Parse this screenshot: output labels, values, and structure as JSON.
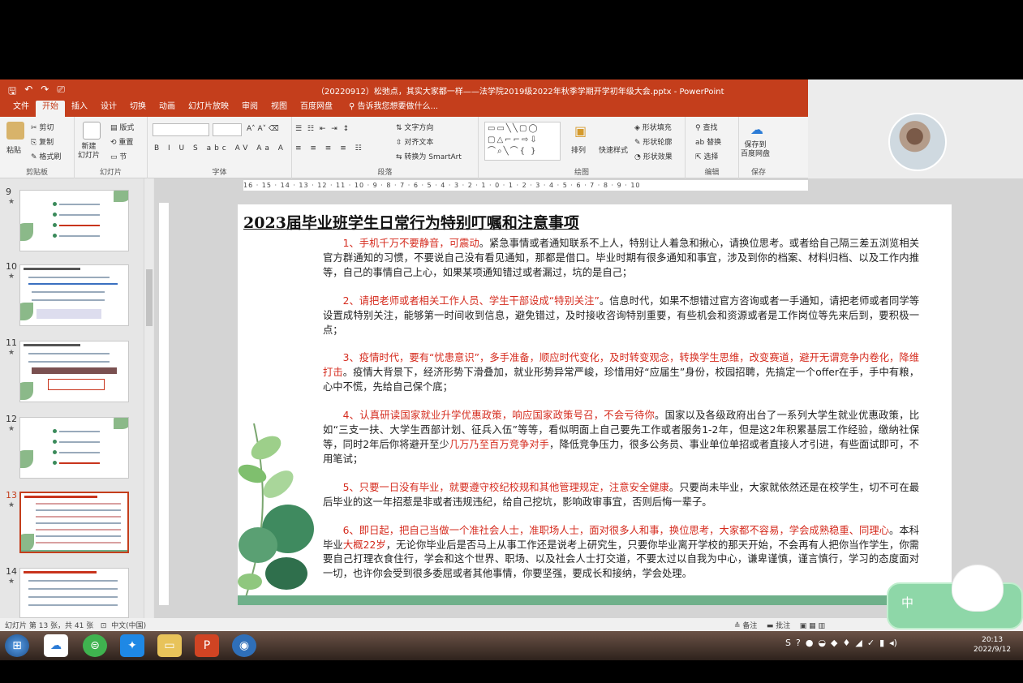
{
  "window": {
    "title": "（20220912）松弛点，其实大家都一样——法学院2019级2022年秋季学期开学初年级大会.pptx - PowerPoint",
    "qat": [
      "🖫",
      "↶",
      "↷",
      "⎚"
    ]
  },
  "ribbon_tabs": [
    "文件",
    "开始",
    "插入",
    "设计",
    "切换",
    "动画",
    "幻灯片放映",
    "审阅",
    "视图",
    "百度网盘"
  ],
  "tell_me": "告诉我您想要做什么...",
  "ribbon": {
    "clipboard": {
      "paste": "粘贴",
      "cut": "剪切",
      "copy": "复制",
      "format_painter": "格式刷",
      "label": "剪贴板"
    },
    "slides": {
      "new_slide": "新建\n幻灯片",
      "layout": "版式",
      "reset": "重置",
      "section": "节",
      "label": "幻灯片"
    },
    "font": {
      "label": "字体"
    },
    "paragraph": {
      "text_direction": "文字方向",
      "align_text": "对齐文本",
      "smartart": "转换为 SmartArt",
      "label": "段落"
    },
    "drawing": {
      "arrange": "排列",
      "quick_styles": "快速样式",
      "shape_fill": "形状填充",
      "shape_outline": "形状轮廓",
      "shape_effects": "形状效果",
      "label": "绘图"
    },
    "editing": {
      "find": "查找",
      "replace": "替换",
      "select": "选择",
      "label": "编辑"
    },
    "save": {
      "save_baidu": "保存到\n百度网盘",
      "label": "保存"
    }
  },
  "ruler_text": "16 · 15 · 14 · 13 · 12 · 11 · 10 · 9 · 8 · 7 · 6 · 5 · 4 · 3 · 2 · 1 · 0 · 1 · 2 · 3 · 4 · 5 · 6 · 7 · 8 · 9 · 10",
  "thumbnails": [
    {
      "num": "9",
      "star": "★"
    },
    {
      "num": "10",
      "star": "★"
    },
    {
      "num": "11",
      "star": "★"
    },
    {
      "num": "12",
      "star": "★"
    },
    {
      "num": "13",
      "star": "★"
    },
    {
      "num": "14",
      "star": "★"
    }
  ],
  "slide": {
    "title": "2023届毕业班学生日常行为特别叮嘱和注意事项",
    "paragraphs": [
      {
        "red": "1、手机千万不要静音，可震动",
        "black": "。紧急事情或者通知联系不上人，特别让人着急和揪心，请换位思考。或者给自己隔三差五浏览相关官方群通知的习惯，不要说自己没有看见通知，那都是借口。毕业时期有很多通知和事宜，涉及到你的档案、材料归档、以及工作内推等，自己的事情自己上心，如果某项通知错过或者漏过，坑的是自己；"
      },
      {
        "red": "2、请把老师或者相关工作人员、学生干部设成“特别关注”",
        "black": "。信息时代，如果不想错过官方咨询或者一手通知，请把老师或者同学等设置成特别关注，能够第一时间收到信息，避免错过，及时接收咨询特别重要，有些机会和资源或者是工作岗位等先来后到，要积极一点；"
      },
      {
        "red": "3、疫情时代，要有“忧患意识”，多手准备，顺应时代变化，及时转变观念，转换学生思维，改变赛道，避开无谓竞争内卷化，降维打击",
        "black": "。疫情大背景下，经济形势下滑叠加，就业形势异常严峻，珍惜用好“应届生”身份，校园招聘，先搞定一个offer在手，手中有粮，心中不慌，先给自己保个底；"
      },
      {
        "red": "4、认真研读国家就业升学优惠政策，响应国家政策号召，不会亏待你",
        "black": "。国家以及各级政府出台了一系列大学生就业优惠政策，比如“三支一扶、大学生西部计划、征兵入伍”等等，看似明面上自己要先工作或者服务1-2年，但是这2年积累基层工作经验，缴纳社保等，同时2年后你将避开至少",
        "red2": "几万乃至百万竞争对手",
        "black2": "，降低竞争压力，很多公务员、事业单位单招或者直接人才引进，有些面试即可，不用笔试；"
      },
      {
        "red": "5、只要一日没有毕业，就要遵守校纪校规和其他管理规定，注意安全健康",
        "black": "。只要尚未毕业，大家就依然还是在校学生，切不可在最后毕业的这一年招惹是非或者违规违纪，给自己挖坑，影响政审事宜，否则后悔一辈子。"
      },
      {
        "red": "6、即日起，把自己当做一个准社会人士，准职场人士，面对很多人和事，换位思考，大家都不容易，学会成熟稳重、同理心",
        "black": "。本科毕业",
        "red2": "大概22岁",
        "black2": "，无论你毕业后是否马上从事工作还是说考上研究生，只要你毕业离开学校的那天开始，不会再有人把你当作学生，你需要自己打理衣食住行，学会和这个世界、职场、以及社会人士打交道，不要太过以自我为中心，谦卑谨慎，谨言慎行，学习的态度面对一切，也许你会受到很多委屈或者其他事情，你要坚强，要成长和接纳，学会处理。"
      }
    ]
  },
  "status": {
    "slide_info": "幻灯片 第 13 张，共 41 张",
    "language": "中文(中国)",
    "notes": "备注",
    "comments": "批注"
  },
  "taskbar": {
    "icons": [
      "start-orb",
      "baidu-netdisk",
      "browser",
      "feishu",
      "explorer",
      "powerpoint",
      "app"
    ],
    "clock_time": "20:13",
    "clock_date": "2022/9/12"
  },
  "ime": {
    "label": "中"
  },
  "colors": {
    "accent": "#c43e1c",
    "red_text": "#d52b1e",
    "slide_bottom_bar": "#6fb08a"
  }
}
